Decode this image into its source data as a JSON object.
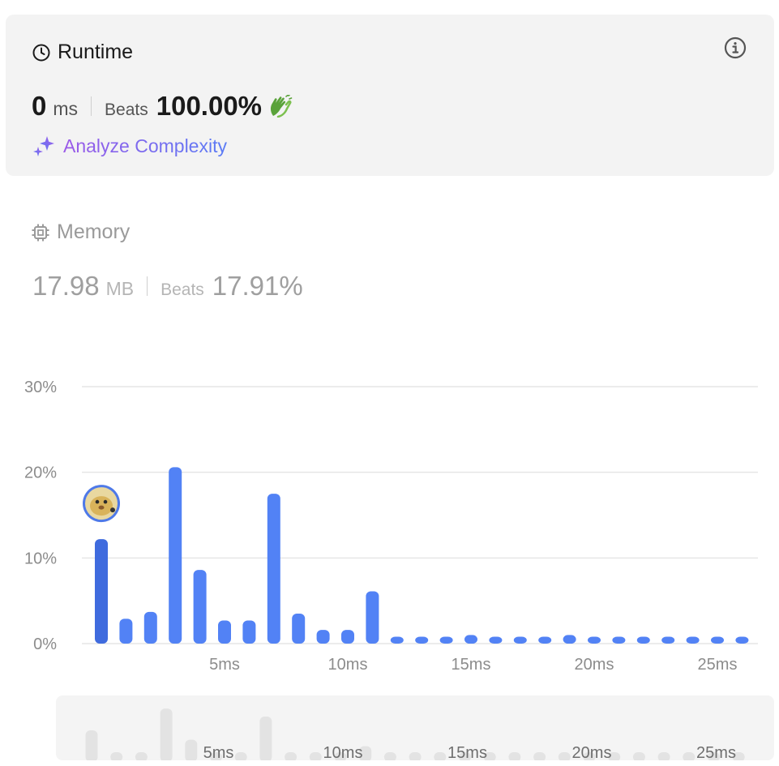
{
  "runtime": {
    "title": "Runtime",
    "value": "0",
    "unit": "ms",
    "beats_label": "Beats",
    "beats_pct": "100.00%",
    "analyze_label": "Analyze Complexity"
  },
  "memory": {
    "title": "Memory",
    "value": "17.98",
    "unit": "MB",
    "beats_label": "Beats",
    "beats_pct": "17.91%"
  },
  "colors": {
    "bar": "#5282f5",
    "bar_highlight": "#3f6bde",
    "overview_bar": "#e3e3e3",
    "accent_purple": "#7b5ce8"
  },
  "chart_data": {
    "type": "bar",
    "title": "",
    "xlabel": "",
    "ylabel": "",
    "ylim": [
      0,
      30
    ],
    "yticks": [
      "0%",
      "10%",
      "20%",
      "30%"
    ],
    "xticks": [
      "5ms",
      "10ms",
      "15ms",
      "20ms",
      "25ms"
    ],
    "x": [
      1,
      2,
      3,
      4,
      5,
      6,
      7,
      8,
      9,
      10,
      11,
      12,
      13,
      14,
      15,
      16,
      17,
      18,
      19,
      20,
      21,
      22,
      23,
      24,
      25,
      26,
      27
    ],
    "values": [
      12.2,
      2.9,
      3.7,
      20.6,
      8.6,
      2.7,
      2.7,
      17.5,
      3.5,
      1.6,
      1.6,
      6.1,
      0.8,
      0.8,
      0.8,
      1.0,
      0.8,
      0.8,
      0.8,
      1.0,
      0.8,
      0.8,
      0.8,
      0.8,
      0.8,
      0.8,
      0.8
    ],
    "highlight_index": 0,
    "grid": true
  },
  "overview": {
    "xticks": [
      "5ms",
      "10ms",
      "15ms",
      "20ms",
      "25ms"
    ]
  }
}
